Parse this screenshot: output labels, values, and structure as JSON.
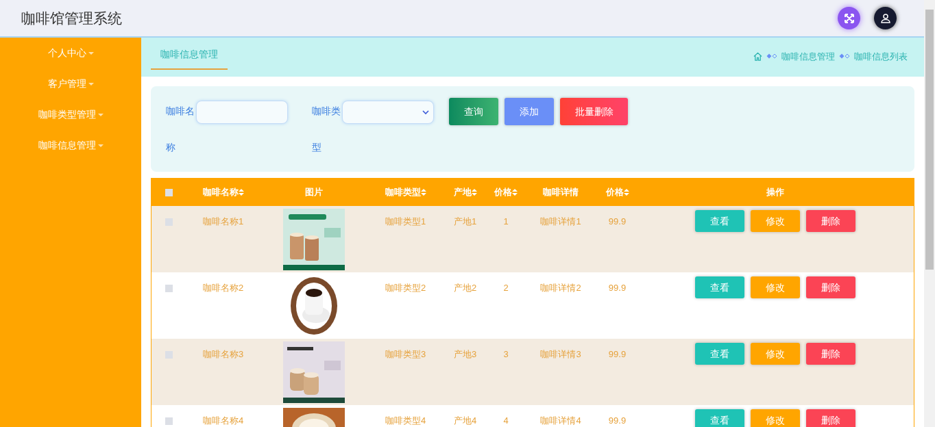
{
  "header": {
    "title": "咖啡馆管理系统"
  },
  "sidebar": {
    "items": [
      {
        "label": "个人中心"
      },
      {
        "label": "客户管理"
      },
      {
        "label": "咖啡类型管理"
      },
      {
        "label": "咖啡信息管理"
      }
    ]
  },
  "breadcrumb_bar": {
    "tab": {
      "label": "咖啡信息管理",
      "selected": true
    },
    "crumbs": [
      "咖啡信息管理",
      "咖啡信息列表"
    ]
  },
  "search": {
    "fields": [
      {
        "kind": "text",
        "label": "咖啡名称"
      },
      {
        "kind": "select",
        "label": "咖啡类型"
      }
    ],
    "buttons": [
      {
        "kind": "search",
        "label": "查询"
      },
      {
        "kind": "add",
        "label": "添加"
      },
      {
        "kind": "delete",
        "label": "批量删除"
      }
    ]
  },
  "table": {
    "header_checked": false,
    "columns": [
      {
        "label": "咖啡名称",
        "sortable": true
      },
      {
        "label": "图片",
        "sortable": false
      },
      {
        "label": "咖啡类型",
        "sortable": true
      },
      {
        "label": "产地",
        "sortable": true
      },
      {
        "label": "价格",
        "sortable": true
      },
      {
        "label": "咖啡详情",
        "sortable": false
      },
      {
        "label": "价格",
        "sortable": true
      },
      {
        "label": "操作",
        "sortable": false
      }
    ],
    "rows": [
      {
        "checked": false,
        "name": "咖啡名称1",
        "type": "咖啡类型1",
        "origin": "产地1",
        "price": "1",
        "detail": "咖啡详情1",
        "price_2": "99.9",
        "actions": [
          "查看",
          "修改",
          "删除"
        ]
      },
      {
        "checked": false,
        "name": "咖啡名称2",
        "type": "咖啡类型2",
        "origin": "产地2",
        "price": "2",
        "detail": "咖啡详情2",
        "price_2": "99.9",
        "actions": [
          "查看",
          "修改",
          "删除"
        ]
      },
      {
        "checked": false,
        "name": "咖啡名称3",
        "type": "咖啡类型3",
        "origin": "产地3",
        "price": "3",
        "detail": "咖啡详情3",
        "price_2": "99.9",
        "actions": [
          "查看",
          "修改",
          "删除"
        ]
      },
      {
        "checked": false,
        "name": "咖啡名称4",
        "type": "咖啡类型4",
        "origin": "产地4",
        "price": "4",
        "detail": "咖啡详情4",
        "price_2": "99.9",
        "actions": [
          "查看",
          "修改",
          "删除"
        ]
      }
    ]
  }
}
